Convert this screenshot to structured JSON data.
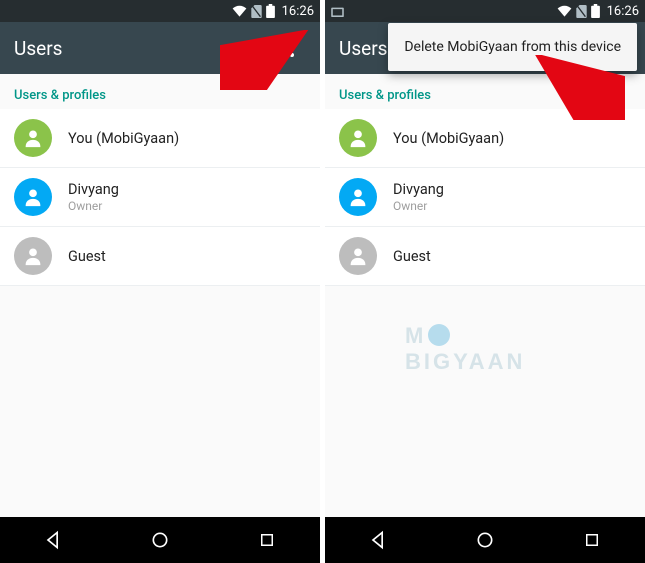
{
  "status": {
    "time": "16:26"
  },
  "left": {
    "title": "Users",
    "section_header": "Users & profiles",
    "users": [
      {
        "name": "You (MobiGyaan)",
        "sub": ""
      },
      {
        "name": "Divyang",
        "sub": "Owner"
      },
      {
        "name": "Guest",
        "sub": ""
      }
    ]
  },
  "right": {
    "title": "Users",
    "section_header": "Users & profiles",
    "users": [
      {
        "name": "You (MobiGyaan)",
        "sub": ""
      },
      {
        "name": "Divyang",
        "sub": "Owner"
      },
      {
        "name": "Guest",
        "sub": ""
      }
    ],
    "menu_item": "Delete MobiGyaan from this device"
  },
  "watermark": "M BIGYAAN"
}
